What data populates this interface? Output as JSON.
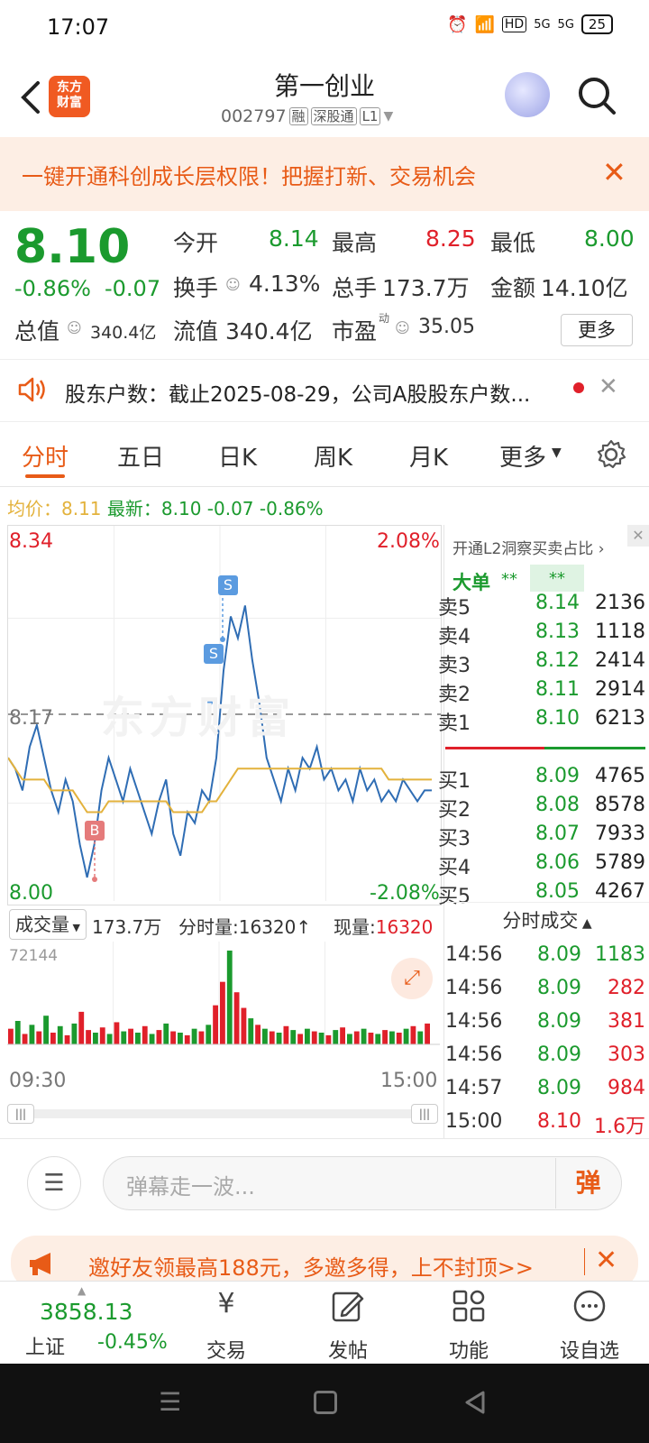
{
  "status_bar": {
    "time": "17:07",
    "network": "5G",
    "battery": "25"
  },
  "header": {
    "logo_text": "东方\n财富",
    "stock_name": "第一创业",
    "stock_code": "002797",
    "tags": [
      "融",
      "深股通",
      "L1"
    ]
  },
  "banner": {
    "text": "一键开通科创成长层权限！把握打新、交易机会"
  },
  "quote": {
    "price": "8.10",
    "change_pct": "-0.86%",
    "change_amt": "-0.07",
    "open_label": "今开",
    "open": "8.14",
    "high_label": "最高",
    "high": "8.25",
    "low_label": "最低",
    "low": "8.00",
    "turnover_label": "换手",
    "turnover": "4.13%",
    "volume_label": "总手",
    "volume": "173.7万",
    "amount_label": "金额",
    "amount": "14.10亿",
    "mktcap_label": "总值",
    "mktcap": "340.4亿",
    "float_label": "流值",
    "float": "340.4亿",
    "pe_label": "市盈",
    "pe_sup": "动",
    "pe": "35.05",
    "more_label": "更多"
  },
  "notice": {
    "text": "股东户数：截止2025-08-29，公司A股股东户数..."
  },
  "tabs": [
    {
      "label": "分时"
    },
    {
      "label": "五日"
    },
    {
      "label": "日K"
    },
    {
      "label": "周K"
    },
    {
      "label": "月K"
    },
    {
      "label": "更多"
    }
  ],
  "avg": {
    "avg_label": "均价：",
    "avg": "8.11",
    "last_label": "最新：",
    "last": "8.10",
    "chg": "-0.07",
    "pct": "-0.86%"
  },
  "chart": {
    "y_max": "8.34",
    "y_min": "8.00",
    "pct_max": "2.08%",
    "pct_min": "-2.08%",
    "ref_price": "8.17",
    "watermark": "东方财富",
    "x_start": "09:30",
    "x_end": "15:00",
    "markers": [
      "S",
      "S",
      "B"
    ],
    "vol_label": "成交量",
    "vol_total": "173.7万",
    "fs_vol_label": "分时量:",
    "fs_vol": "16320",
    "now_vol_label": "现量:",
    "now_vol": "16320",
    "vol_max": "72144"
  },
  "chart_data": {
    "type": "line",
    "series": [
      {
        "values": [
          8.13,
          8.12,
          8.1,
          8.14,
          8.16,
          8.13,
          8.1,
          8.08,
          8.11,
          8.09,
          8.05,
          8.02,
          8.05,
          8.1,
          8.13,
          8.11,
          8.09,
          8.12,
          8.1,
          8.08,
          8.06,
          8.09,
          8.11,
          8.06,
          8.04,
          8.08,
          8.07,
          8.1,
          8.09,
          8.13,
          8.21,
          8.26,
          8.24,
          8.27,
          8.22,
          8.18,
          8.13,
          8.11,
          8.09,
          8.12,
          8.1,
          8.13,
          8.12,
          8.14,
          8.11,
          8.12,
          8.1,
          8.11,
          8.09,
          8.12,
          8.1,
          8.11,
          8.09,
          8.1,
          8.09,
          8.11,
          8.1,
          8.09,
          8.1,
          8.1
        ]
      },
      {
        "values": [
          8.13,
          8.12,
          8.11,
          8.11,
          8.11,
          8.11,
          8.1,
          8.1,
          8.1,
          8.1,
          8.09,
          8.08,
          8.08,
          8.08,
          8.09,
          8.09,
          8.09,
          8.09,
          8.09,
          8.09,
          8.09,
          8.09,
          8.09,
          8.08,
          8.08,
          8.08,
          8.08,
          8.08,
          8.09,
          8.09,
          8.1,
          8.11,
          8.12,
          8.12,
          8.12,
          8.12,
          8.12,
          8.12,
          8.12,
          8.12,
          8.12,
          8.12,
          8.12,
          8.12,
          8.12,
          8.12,
          8.12,
          8.12,
          8.12,
          8.12,
          8.12,
          8.12,
          8.12,
          8.11,
          8.11,
          8.11,
          8.11,
          8.11,
          8.11,
          8.11
        ]
      }
    ],
    "ylim": [
      8.0,
      8.34
    ],
    "volume": [
      12,
      18,
      8,
      15,
      10,
      22,
      9,
      14,
      7,
      16,
      25,
      11,
      9,
      13,
      8,
      17,
      10,
      12,
      9,
      14,
      8,
      11,
      16,
      10,
      9,
      7,
      12,
      10,
      15,
      30,
      48,
      72,
      40,
      28,
      20,
      15,
      12,
      10,
      9,
      14,
      11,
      8,
      12,
      10,
      9,
      7,
      11,
      13,
      8,
      10,
      12,
      9,
      8,
      11,
      10,
      9,
      12,
      14,
      10,
      16
    ],
    "volume_colors": [
      "r",
      "g",
      "r",
      "g",
      "r",
      "g",
      "r",
      "g",
      "r",
      "g",
      "r",
      "r",
      "g",
      "r",
      "g",
      "r",
      "g",
      "r",
      "g",
      "r",
      "g",
      "r",
      "g",
      "r",
      "g",
      "r",
      "g",
      "r",
      "g",
      "r",
      "r",
      "g",
      "r",
      "r",
      "g",
      "r",
      "g",
      "r",
      "g",
      "r",
      "g",
      "r",
      "g",
      "r",
      "g",
      "r",
      "g",
      "r",
      "g",
      "r",
      "g",
      "r",
      "g",
      "r",
      "g",
      "r",
      "g",
      "r",
      "g",
      "r"
    ]
  },
  "l2": {
    "title": "开通L2洞察买卖占比",
    "big_label": "大单",
    "big_v1": "**",
    "big_v2": "**"
  },
  "asks": [
    {
      "label": "卖5",
      "price": "8.14",
      "vol": "2136"
    },
    {
      "label": "卖4",
      "price": "8.13",
      "vol": "1118"
    },
    {
      "label": "卖3",
      "price": "8.12",
      "vol": "2414"
    },
    {
      "label": "卖2",
      "price": "8.11",
      "vol": "2914"
    },
    {
      "label": "卖1",
      "price": "8.10",
      "vol": "6213"
    }
  ],
  "bids": [
    {
      "label": "买1",
      "price": "8.09",
      "vol": "4765"
    },
    {
      "label": "买2",
      "price": "8.08",
      "vol": "8578"
    },
    {
      "label": "买3",
      "price": "8.07",
      "vol": "7933"
    },
    {
      "label": "买4",
      "price": "8.06",
      "vol": "5789"
    },
    {
      "label": "买5",
      "price": "8.05",
      "vol": "4267"
    }
  ],
  "ticks_title": "分时成交",
  "ticks": [
    {
      "time": "14:56",
      "price": "8.09",
      "vol": "1183",
      "color": "g"
    },
    {
      "time": "14:56",
      "price": "8.09",
      "vol": "282",
      "color": "r"
    },
    {
      "time": "14:56",
      "price": "8.09",
      "vol": "381",
      "color": "r"
    },
    {
      "time": "14:56",
      "price": "8.09",
      "vol": "303",
      "color": "r"
    },
    {
      "time": "14:57",
      "price": "8.09",
      "vol": "984",
      "color": "r"
    },
    {
      "time": "15:00",
      "price": "8.10",
      "vol": "1.6万",
      "color": "r"
    }
  ],
  "comment": {
    "placeholder": "弹幕走一波...",
    "danmu_btn": "弹"
  },
  "promo": {
    "text": "邀好友领最高188元，多邀多得，上不封顶>>"
  },
  "bottom_nav": {
    "index_value": "3858.13",
    "index_name": "上证",
    "index_chg": "-0.45%",
    "items": [
      {
        "label": "交易"
      },
      {
        "label": "发帖"
      },
      {
        "label": "功能"
      },
      {
        "label": "设自选"
      }
    ]
  },
  "colors": {
    "green": "#1b9a2e",
    "red": "#e0202a",
    "orange": "#e85b17",
    "blue": "#2f6db4",
    "avg": "#e3b23c"
  }
}
